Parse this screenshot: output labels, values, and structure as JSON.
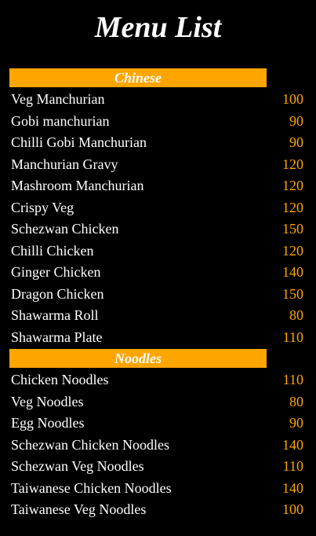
{
  "title": "Menu List",
  "colors": {
    "background": "#000000",
    "accent": "#ffa500",
    "text": "#ffffff"
  },
  "sections": [
    {
      "header": "Chinese",
      "items": [
        {
          "name": "Veg Manchurian",
          "price": "100"
        },
        {
          "name": "Gobi manchurian",
          "price": "90"
        },
        {
          "name": "Chilli Gobi Manchurian",
          "price": "90"
        },
        {
          "name": "Manchurian Gravy",
          "price": "120"
        },
        {
          "name": "Mashroom Manchurian",
          "price": "120"
        },
        {
          "name": "Crispy Veg",
          "price": "120"
        },
        {
          "name": "Schezwan Chicken",
          "price": "150"
        },
        {
          "name": "Chilli Chicken",
          "price": "120"
        },
        {
          "name": "Ginger Chicken",
          "price": "140"
        },
        {
          "name": "Dragon Chicken",
          "price": "150"
        },
        {
          "name": "Shawarma Roll",
          "price": "80"
        },
        {
          "name": "Shawarma Plate",
          "price": "110"
        }
      ]
    },
    {
      "header": "Noodles",
      "items": [
        {
          "name": "Chicken Noodles",
          "price": "110"
        },
        {
          "name": "Veg Noodles",
          "price": "80"
        },
        {
          "name": "Egg Noodles",
          "price": "90"
        },
        {
          "name": "Schezwan Chicken Noodles",
          "price": "140"
        },
        {
          "name": "Schezwan Veg Noodles",
          "price": "110"
        },
        {
          "name": "Taiwanese Chicken Noodles",
          "price": "140"
        },
        {
          "name": "Taiwanese Veg Noodles",
          "price": "100"
        }
      ]
    }
  ]
}
